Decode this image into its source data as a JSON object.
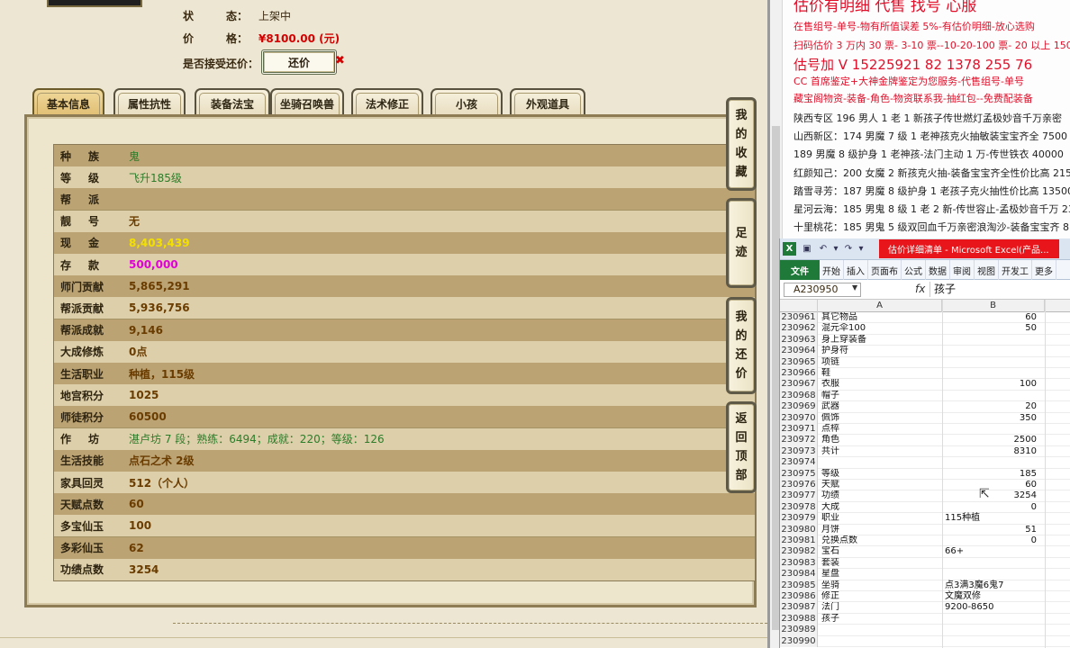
{
  "left": {
    "status_label": "状　　　态：",
    "status_value": "上架中",
    "price_label": "价　　　格：",
    "price_value": "¥8100.00 (元)",
    "bargain_label": "是否接受还价：",
    "bargain_button": "还价",
    "bargain_close": "✖",
    "tabs": [
      "基本信息",
      "属性抗性",
      "装备法宝",
      "坐骑召唤兽",
      "法术修正",
      "小孩",
      "外观道具"
    ],
    "rows": [
      {
        "k": "种族",
        "v": "鬼",
        "style": "green",
        "spread": true
      },
      {
        "k": "等级",
        "v": "飞升185级",
        "style": "green",
        "spread": true
      },
      {
        "k": "帮派",
        "v": "",
        "style": "",
        "spread": true
      },
      {
        "k": "靓号",
        "v": "无",
        "style": "",
        "spread": true
      },
      {
        "k": "现金",
        "v": "8,403,439",
        "style": "yellow",
        "spread": true
      },
      {
        "k": "存款",
        "v": "500,000",
        "style": "magenta",
        "spread": true
      },
      {
        "k": "师门贡献",
        "v": "5,865,291",
        "style": "",
        "spread": false
      },
      {
        "k": "帮派贡献",
        "v": "5,936,756",
        "style": "",
        "spread": false
      },
      {
        "k": "帮派成就",
        "v": "9,146",
        "style": "",
        "spread": false
      },
      {
        "k": "大成修炼",
        "v": "0点",
        "style": "",
        "spread": false
      },
      {
        "k": "生活职业",
        "v": "种植，115级",
        "style": "",
        "spread": false
      },
      {
        "k": "地宫积分",
        "v": "1025",
        "style": "",
        "spread": false
      },
      {
        "k": "师徒积分",
        "v": "60500",
        "style": "",
        "spread": false
      },
      {
        "k": "作坊",
        "v": "湛卢坊 7 段；熟练：6494；成就：220；等级：126",
        "style": "teal",
        "spread": true
      },
      {
        "k": "生活技能",
        "v": "点石之术 2级",
        "style": "",
        "spread": false
      },
      {
        "k": "家具回灵",
        "v": "512（个人）",
        "style": "",
        "spread": false
      },
      {
        "k": "天赋点数",
        "v": "60",
        "style": "",
        "spread": false
      },
      {
        "k": "多宝仙玉",
        "v": "100",
        "style": "",
        "spread": false
      },
      {
        "k": "多彩仙玉",
        "v": "62",
        "style": "",
        "spread": false
      },
      {
        "k": "功绩点数",
        "v": "3254",
        "style": "",
        "spread": false
      }
    ],
    "side_buttons": {
      "fav": [
        "我",
        "的",
        "收",
        "藏"
      ],
      "foot": [
        "足",
        "迹"
      ],
      "bargain": [
        "我",
        "的",
        "还",
        "价"
      ],
      "top": [
        "返",
        "回",
        "顶",
        "部"
      ]
    }
  },
  "notes": {
    "headline": "估价有明细 代售 找号 心服",
    "lines": [
      {
        "text": "在售组号-单号-物有所值误差 5%-有估价明细-放心选购",
        "cls": ""
      },
      {
        "text": "扫码估价 3 万内 30 票- 3-10 票--10-20-100 票- 20 以上 150",
        "cls": ""
      },
      {
        "text": "估号加 V 15225921 82   1378 255 76",
        "cls": "big"
      },
      {
        "text": "CC 首席鉴定+大神金牌鉴定为您服务-代售组号-单号",
        "cls": ""
      },
      {
        "text": "藏宝阁物资-装备-角色-物资联系我-抽红包--免费配装备",
        "cls": ""
      },
      {
        "text": "陕西专区 196 男人 1 老 1 新孩子传世燃灯孟极妙音千万亲密",
        "cls": "dark"
      },
      {
        "text": "山西新区：174 男魔 7 级 1 老神孩克火抽敏装宝宝齐全 7500",
        "cls": "dark"
      },
      {
        "text": "189 男魔 8 级护身 1 老神孩-法门主动 1 万-传世铁衣 40000",
        "cls": "dark"
      },
      {
        "text": "红颜知己：200 女魔 2 新孩克火抽-装备宝宝齐全性价比高 215",
        "cls": "dark"
      },
      {
        "text": "踏雪寻芳：187 男魔 8 级护身 1 老孩子克火抽性价比高 13500",
        "cls": "dark"
      },
      {
        "text": "星河云海：185 男鬼 8 级 1 老 2 新-传世容止-孟极妙音千万 230",
        "cls": "dark"
      },
      {
        "text": "十里桃花：185 男鬼 5 级双回血千万亲密浪淘沙-装备宝宝齐 8",
        "cls": "dark"
      }
    ]
  },
  "excel": {
    "window_title": "估价详细清单 - Microsoft Excel(产品...",
    "logo": "X",
    "ribbon_tabs": [
      "文件",
      "开始",
      "插入",
      "页面布",
      "公式",
      "数据",
      "审阅",
      "视图",
      "开发工",
      "更多"
    ],
    "namebox": "A230950",
    "fx": "fx",
    "formula_value": "孩子",
    "col_a": "A",
    "col_b": "B",
    "rows": [
      {
        "n": "230961",
        "a": "其它物品",
        "b": "60",
        "left": false
      },
      {
        "n": "230962",
        "a": "混元伞100",
        "b": "50",
        "left": false
      },
      {
        "n": "230963",
        "a": "身上穿装备",
        "b": "",
        "left": false
      },
      {
        "n": "230964",
        "a": "护身符",
        "b": "",
        "left": false
      },
      {
        "n": "230965",
        "a": "项链",
        "b": "",
        "left": false
      },
      {
        "n": "230966",
        "a": "鞋",
        "b": "",
        "left": false
      },
      {
        "n": "230967",
        "a": "衣服",
        "b": "100",
        "left": false
      },
      {
        "n": "230968",
        "a": "帽子",
        "b": "",
        "left": false
      },
      {
        "n": "230969",
        "a": "武器",
        "b": "20",
        "left": false
      },
      {
        "n": "230970",
        "a": "佩饰",
        "b": "350",
        "left": false
      },
      {
        "n": "230971",
        "a": "点椊",
        "b": "",
        "left": false
      },
      {
        "n": "230972",
        "a": "角色",
        "b": "2500",
        "left": false
      },
      {
        "n": "230973",
        "a": "共计",
        "b": "8310",
        "left": false
      },
      {
        "n": "230974",
        "a": "",
        "b": "",
        "left": false
      },
      {
        "n": "230975",
        "a": "等级",
        "b": "185",
        "left": false
      },
      {
        "n": "230976",
        "a": "天赋",
        "b": "60",
        "left": false
      },
      {
        "n": "230977",
        "a": "功绩",
        "b": "3254",
        "left": false
      },
      {
        "n": "230978",
        "a": "大成",
        "b": "0",
        "left": false
      },
      {
        "n": "230979",
        "a": "职业",
        "b": "115种植",
        "left": true
      },
      {
        "n": "230980",
        "a": "月饼",
        "b": "51",
        "left": false
      },
      {
        "n": "230981",
        "a": "兑换点数",
        "b": "0",
        "left": false
      },
      {
        "n": "230982",
        "a": "宝石",
        "b": "66+",
        "left": true
      },
      {
        "n": "230983",
        "a": "套装",
        "b": "",
        "left": false
      },
      {
        "n": "230984",
        "a": "星盘",
        "b": "",
        "left": false
      },
      {
        "n": "230985",
        "a": "坐骑",
        "b": "点3满3魔6鬼7",
        "left": true
      },
      {
        "n": "230986",
        "a": "修正",
        "b": "文魔双修",
        "left": true
      },
      {
        "n": "230987",
        "a": "法门",
        "b": "9200-8650",
        "left": true
      },
      {
        "n": "230988",
        "a": "孩子",
        "b": "",
        "left": false
      },
      {
        "n": "230989",
        "a": "",
        "b": "",
        "left": false
      },
      {
        "n": "230990",
        "a": "",
        "b": "",
        "left": false
      }
    ]
  }
}
